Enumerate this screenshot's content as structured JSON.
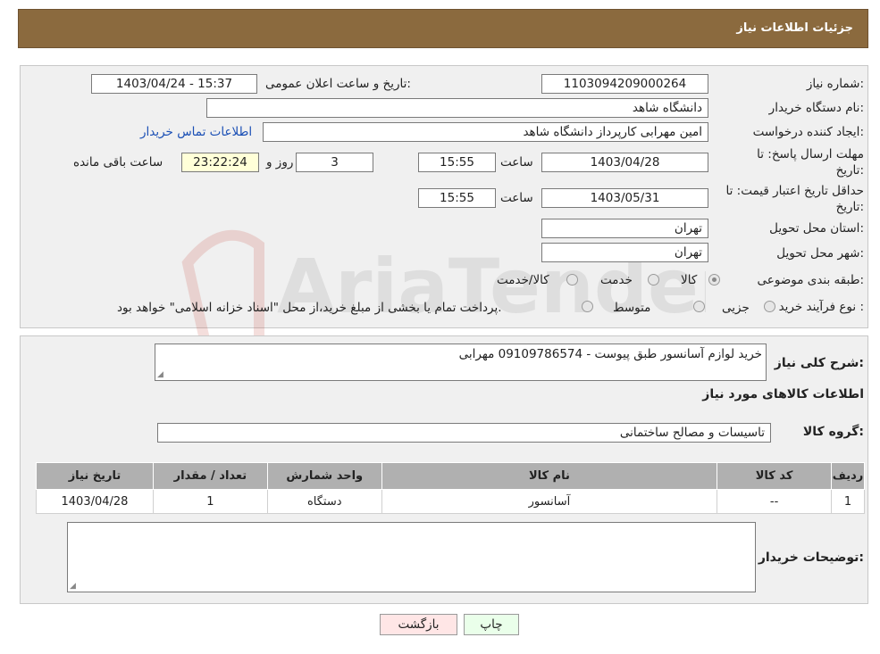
{
  "header": {
    "title": "جزئیات اطلاعات نیاز"
  },
  "form": {
    "need_number_label": "شماره نیاز:",
    "need_number": "1103094209000264",
    "announce_label": "تاریخ و ساعت اعلان عمومی:",
    "announce_value": "1403/04/24 - 15:37",
    "buyer_org_label": "نام دستگاه خریدار:",
    "buyer_org": "دانشگاه شاهد",
    "requester_label": "ایجاد کننده درخواست:",
    "requester": "امین مهرابی کارپرداز دانشگاه شاهد",
    "contact_link": "اطلاعات تماس خریدار",
    "deadline_label_1": "مهلت ارسال پاسخ: تا",
    "deadline_label_2": "تاریخ:",
    "deadline_date": "1403/04/28",
    "time_label": "ساعت",
    "deadline_time": "15:55",
    "days_value": "3",
    "days_label": "روز و",
    "remaining_value": "23:22:24",
    "remaining_label": "ساعت باقی مانده",
    "validity_label_1": "حداقل تاریخ اعتبار قیمت: تا",
    "validity_label_2": "تاریخ:",
    "validity_date": "1403/05/31",
    "validity_time": "15:55",
    "province_label": "استان محل تحویل:",
    "province": "تهران",
    "city_label": "شهر محل تحویل:",
    "city": "تهران",
    "category_label": "طبقه بندی موضوعی:",
    "category_options": [
      "کالا",
      "خدمت",
      "کالا/خدمت"
    ],
    "process_label": "نوع فرآیند خرید :",
    "process_options": [
      "جزیی",
      "متوسط"
    ],
    "process_note": "پرداخت تمام یا بخشی از مبلغ خرید،از محل \"اسناد خزانه اسلامی\" خواهد بود."
  },
  "details": {
    "summary_label": "شرح کلی نیاز:",
    "summary_value": "خرید لوازم آسانسور طبق پیوست - 09109786574 مهرابی",
    "items_title": "اطلاعات کالاهای مورد نیاز",
    "group_label": "گروه کالا:",
    "group_value": "تاسیسات و مصالح ساختمانی",
    "table": {
      "headers": [
        "ردیف",
        "کد کالا",
        "نام کالا",
        "واحد شمارش",
        "تعداد / مقدار",
        "تاریخ نیاز"
      ],
      "rows": [
        [
          "1",
          "--",
          "آسانسور",
          "دستگاه",
          "1",
          "1403/04/28"
        ]
      ]
    },
    "buyer_notes_label": "توضیحات خریدار:"
  },
  "buttons": {
    "print": "چاپ",
    "back": "بازگشت"
  },
  "watermark": "AriaTender.neT"
}
